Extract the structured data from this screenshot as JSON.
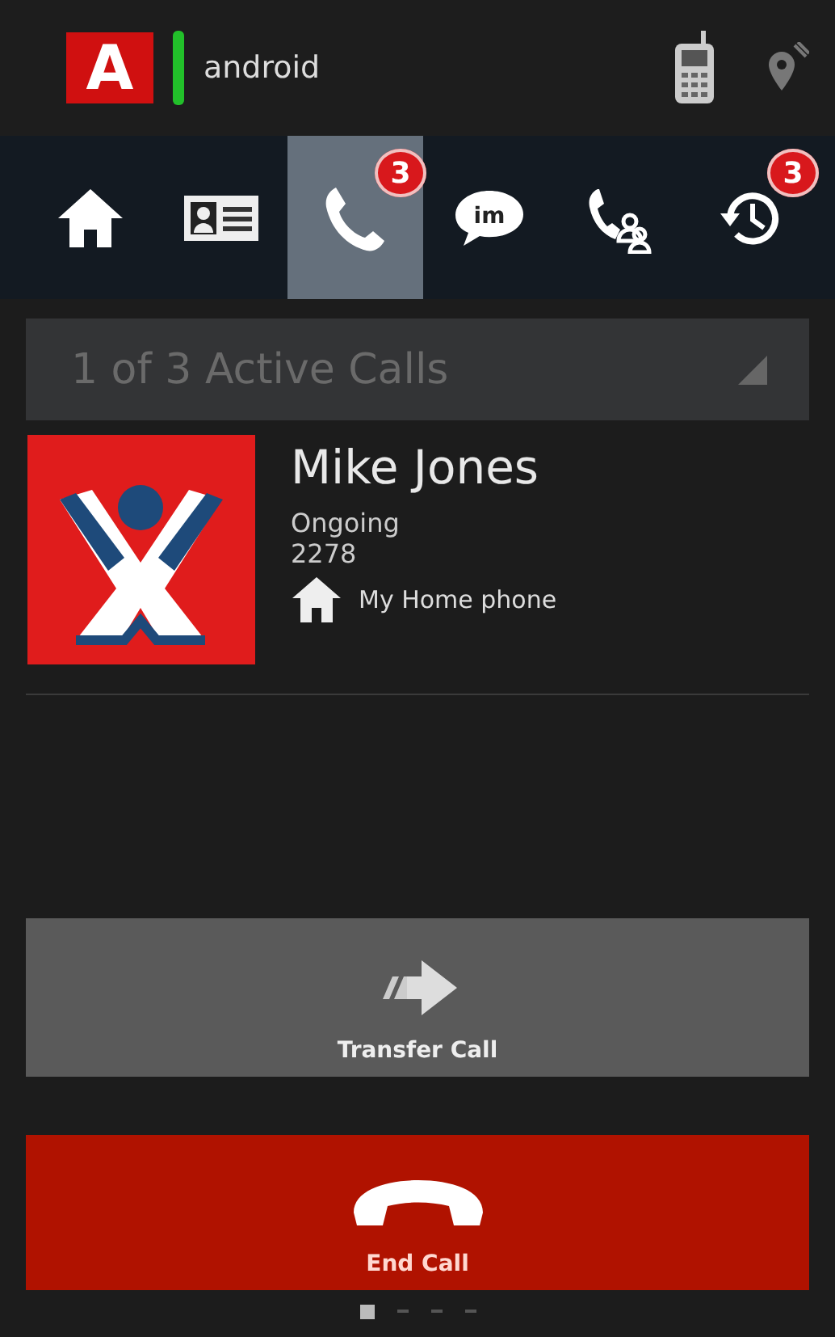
{
  "status_bar": {
    "logo_letter": "A",
    "title": "android"
  },
  "tabs": [
    {
      "kind": "home",
      "selected": false
    },
    {
      "kind": "contacts",
      "selected": false
    },
    {
      "kind": "calls",
      "selected": true,
      "badge": "3"
    },
    {
      "kind": "chat",
      "selected": false,
      "icon_text": "im"
    },
    {
      "kind": "conference",
      "selected": false
    },
    {
      "kind": "history",
      "selected": false,
      "badge": "3"
    }
  ],
  "call_selector": {
    "label": "1 of 3 Active Calls"
  },
  "contact": {
    "name": "Mike Jones",
    "status": "Ongoing",
    "number": "2278",
    "phone_label": "My Home phone"
  },
  "actions": [
    {
      "kind": "transfer",
      "label": "Transfer Call"
    },
    {
      "kind": "end",
      "label": "End Call"
    }
  ],
  "pager": [
    {
      "selected": true
    },
    {
      "selected": false
    },
    {
      "selected": false
    },
    {
      "selected": false
    }
  ]
}
